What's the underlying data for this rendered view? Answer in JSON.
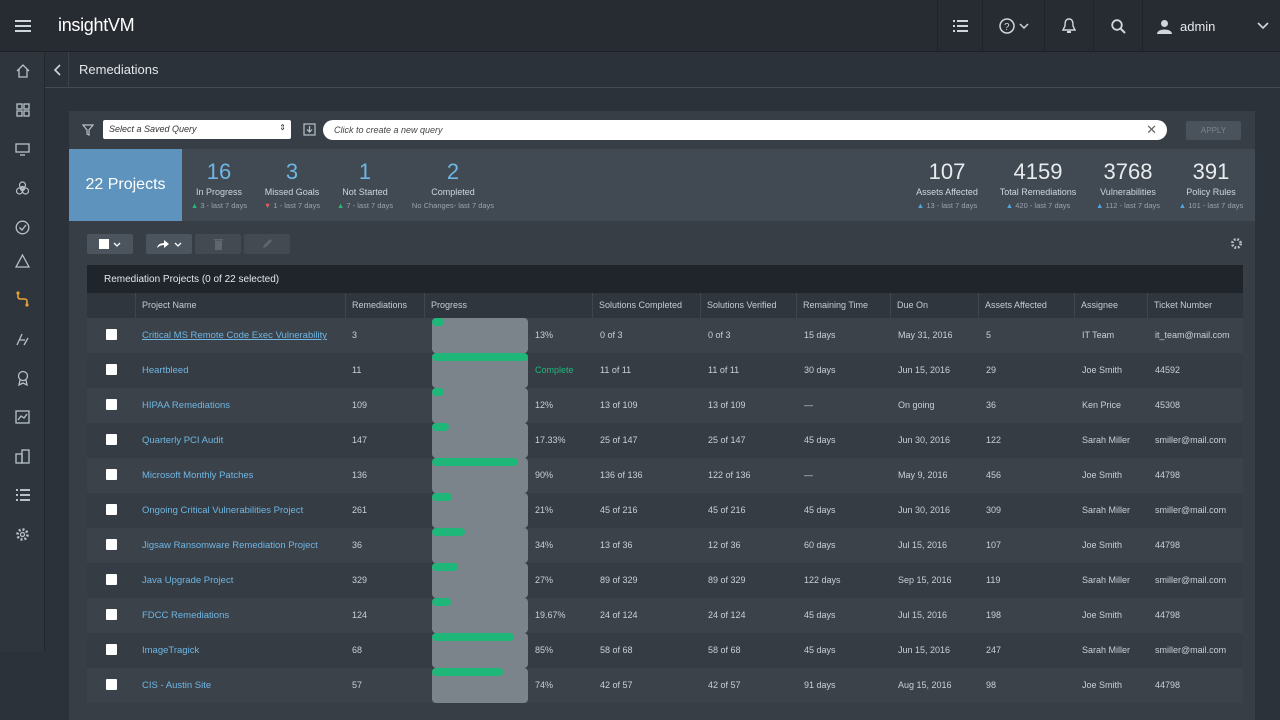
{
  "app": {
    "title": "insightVM",
    "user": "admin"
  },
  "breadcrumb": {
    "title": "Remediations"
  },
  "query": {
    "saved_placeholder": "Select a Saved Query",
    "new_placeholder": "Click to create a new query",
    "apply_label": "APPLY"
  },
  "stats": {
    "projects_label": "22 Projects",
    "in_progress": {
      "value": "16",
      "label": "In Progress",
      "sub": "3 - last 7 days"
    },
    "missed_goals": {
      "value": "3",
      "label": "Missed Goals",
      "sub": "1 - last 7 days"
    },
    "not_started": {
      "value": "1",
      "label": "Not Started",
      "sub": "7 - last 7 days"
    },
    "completed": {
      "value": "2",
      "label": "Completed",
      "sub": "No Changes- last 7 days"
    },
    "assets_affected": {
      "value": "107",
      "label": "Assets Affected",
      "sub": "13 - last 7 days"
    },
    "total_remediations": {
      "value": "4159",
      "label": "Total Remediations",
      "sub": "420 - last 7 days"
    },
    "vulnerabilities": {
      "value": "3768",
      "label": "Vulnerabilities",
      "sub": "112 - last 7 days"
    },
    "policy_rules": {
      "value": "391",
      "label": "Policy Rules",
      "sub": "101 - last 7 days"
    }
  },
  "table": {
    "title": "Remediation Projects (0 of 22 selected)",
    "columns": [
      "Project Name",
      "Remediations",
      "Progress",
      "Solutions Completed",
      "Solutions Verified",
      "Remaining Time",
      "Due On",
      "Assets Affected",
      "Assignee",
      "Ticket Number"
    ],
    "rows": [
      {
        "name": "Critical MS Remote Code Exec Vulnerability",
        "remediations": "3",
        "progress": 0.13,
        "progress_label": "13%",
        "completed": "0 of 3",
        "verified": "0 of 3",
        "remaining": "15 days",
        "due": "May 31, 2016",
        "assets": "5",
        "assignee": "IT Team",
        "ticket": "it_team@mail.com"
      },
      {
        "name": "Heartbleed",
        "remediations": "11",
        "progress": 1.0,
        "progress_label": "Complete",
        "completed": "11 of 11",
        "verified": "11 of 11",
        "remaining": "30 days",
        "due": "Jun 15, 2016",
        "assets": "29",
        "assignee": "Joe Smith",
        "ticket": "44592"
      },
      {
        "name": "HIPAA Remediations",
        "remediations": "109",
        "progress": 0.12,
        "progress_label": "12%",
        "completed": "13 of 109",
        "verified": "13 of 109",
        "remaining": "—",
        "due": "On going",
        "assets": "36",
        "assignee": "Ken Price",
        "ticket": "45308"
      },
      {
        "name": "Quarterly PCI Audit",
        "remediations": "147",
        "progress": 0.1733,
        "progress_label": "17.33%",
        "completed": "25 of 147",
        "verified": "25 of 147",
        "remaining": "45 days",
        "due": "Jun 30, 2016",
        "assets": "122",
        "assignee": "Sarah Miller",
        "ticket": "smiller@mail.com"
      },
      {
        "name": "Microsoft Monthly Patches",
        "remediations": "136",
        "progress": 0.9,
        "progress_label": "90%",
        "completed": "136 of 136",
        "verified": "122 of 136",
        "remaining": "—",
        "due": "May 9, 2016",
        "assets": "456",
        "assignee": "Joe Smith",
        "ticket": "44798"
      },
      {
        "name": "Ongoing Critical Vulnerabilities Project",
        "remediations": "261",
        "progress": 0.21,
        "progress_label": "21%",
        "completed": "45 of 216",
        "verified": "45 of 216",
        "remaining": "45 days",
        "due": "Jun 30, 2016",
        "assets": "309",
        "assignee": "Sarah Miller",
        "ticket": "smiller@mail.com"
      },
      {
        "name": "Jigsaw Ransomware Remediation Project",
        "remediations": "36",
        "progress": 0.34,
        "progress_label": "34%",
        "completed": "13 of 36",
        "verified": "12 of 36",
        "remaining": "60 days",
        "due": "Jul 15, 2016",
        "assets": "107",
        "assignee": "Joe Smith",
        "ticket": "44798"
      },
      {
        "name": "Java Upgrade Project",
        "remediations": "329",
        "progress": 0.27,
        "progress_label": "27%",
        "completed": "89 of 329",
        "verified": "89 of 329",
        "remaining": "122 days",
        "due": "Sep 15, 2016",
        "assets": "119",
        "assignee": "Sarah Miller",
        "ticket": "smiller@mail.com"
      },
      {
        "name": "FDCC Remediations",
        "remediations": "124",
        "progress": 0.1967,
        "progress_label": "19.67%",
        "completed": "24 of 124",
        "verified": "24 of 124",
        "remaining": "45 days",
        "due": "Jul 15, 2016",
        "assets": "198",
        "assignee": "Joe Smith",
        "ticket": "44798"
      },
      {
        "name": "ImageTragick",
        "remediations": "68",
        "progress": 0.85,
        "progress_label": "85%",
        "completed": "58 of 68",
        "verified": "58 of 68",
        "remaining": "45 days",
        "due": "Jun 15, 2016",
        "assets": "247",
        "assignee": "Sarah Miller",
        "ticket": "smiller@mail.com"
      },
      {
        "name": "CIS - Austin Site",
        "remediations": "57",
        "progress": 0.74,
        "progress_label": "74%",
        "completed": "42 of 57",
        "verified": "42 of 57",
        "remaining": "91 days",
        "due": "Aug 15, 2016",
        "assets": "98",
        "assignee": "Joe Smith",
        "ticket": "44798"
      }
    ]
  },
  "colors": {
    "accent": "#5d93bc",
    "link": "#6fb6e3",
    "progress": "#1fb67a"
  }
}
